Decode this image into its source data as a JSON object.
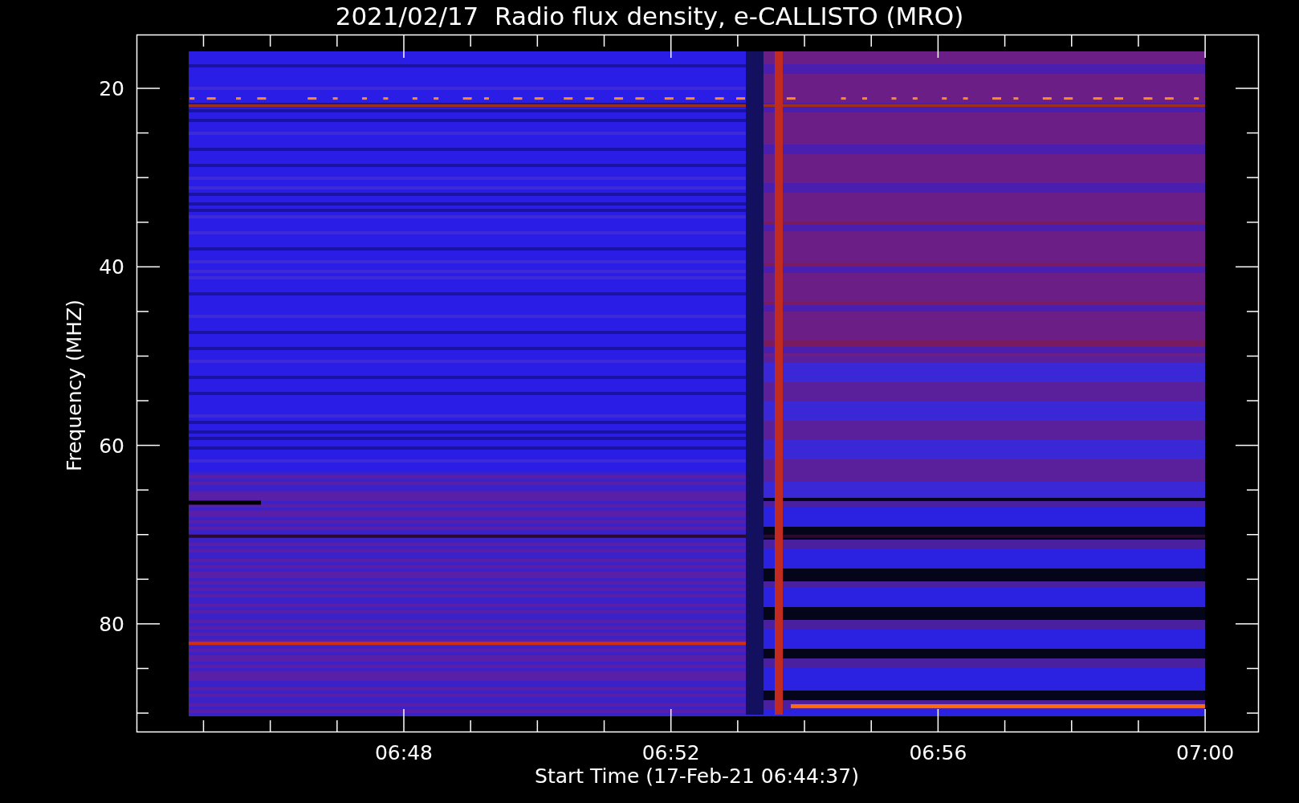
{
  "plot": {
    "title": "2021/02/17  Radio flux density, e-CALLISTO (MRO)",
    "ylabel": "Frequency (MHZ)",
    "xlabel": "Start Time (17-Feb-21 06:44:37)",
    "yticks": [
      "20",
      "40",
      "60",
      "80"
    ],
    "xticks": [
      "06:48",
      "06:52",
      "06:56",
      "07:00"
    ]
  }
}
